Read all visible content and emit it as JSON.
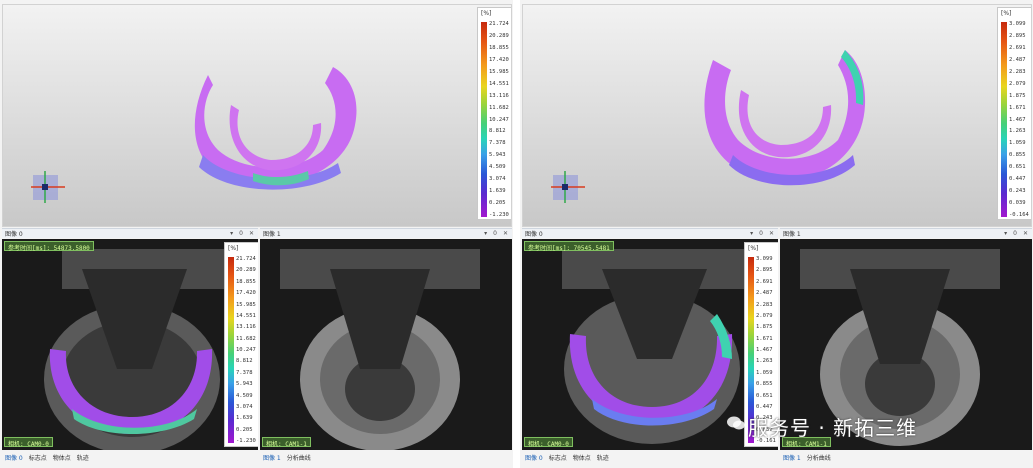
{
  "scale_unit": "[%]",
  "left": {
    "scale_ticks": [
      "21.724",
      "20.289",
      "18.855",
      "17.420",
      "15.985",
      "14.551",
      "13.116",
      "11.682",
      "10.247",
      "8.812",
      "7.378",
      "5.943",
      "4.509",
      "3.074",
      "1.639",
      "0.205",
      "-1.230"
    ],
    "bottom_scale_ticks": [
      "21.724",
      "20.289",
      "18.855",
      "17.420",
      "15.985",
      "14.551",
      "13.116",
      "11.682",
      "10.247",
      "8.812",
      "7.378",
      "5.943",
      "4.509",
      "3.074",
      "1.639",
      "0.205",
      "-1.230"
    ],
    "pane0_title": "图像 0",
    "pane1_title": "图像 1",
    "timebox": "参考时间[ms]: 54873.5800",
    "cam0": "相机: CAM0-0",
    "cam1": "相机: CAM1-1",
    "status_left": [
      "图像 0",
      "标志点",
      "物体点",
      "轨迹"
    ],
    "status_right": [
      "图像 1",
      "分析曲线"
    ]
  },
  "right": {
    "scale_ticks": [
      "3.099",
      "2.895",
      "2.691",
      "2.487",
      "2.283",
      "2.079",
      "1.875",
      "1.671",
      "1.467",
      "1.263",
      "1.059",
      "0.855",
      "0.651",
      "0.447",
      "0.243",
      "0.039",
      "-0.164"
    ],
    "bottom_scale_ticks": [
      "3.099",
      "2.895",
      "2.691",
      "2.487",
      "2.283",
      "2.079",
      "1.875",
      "1.671",
      "1.467",
      "1.263",
      "1.059",
      "0.855",
      "0.651",
      "0.447",
      "0.243",
      "0.039",
      "-0.161"
    ],
    "pane0_title": "图像 0",
    "pane1_title": "图像 1",
    "timebox": "参考时间[ms]: 70545.5481",
    "cam0": "相机: CAM0-0",
    "cam1": "相机: CAM1-1",
    "status_left": [
      "图像 0",
      "标志点",
      "物体点",
      "轨迹"
    ],
    "status_right": [
      "图像 1",
      "分析曲线"
    ]
  },
  "toolbar_controls": [
    "▾",
    "0",
    "✕"
  ],
  "watermark": "服务号 · 新拓三维"
}
